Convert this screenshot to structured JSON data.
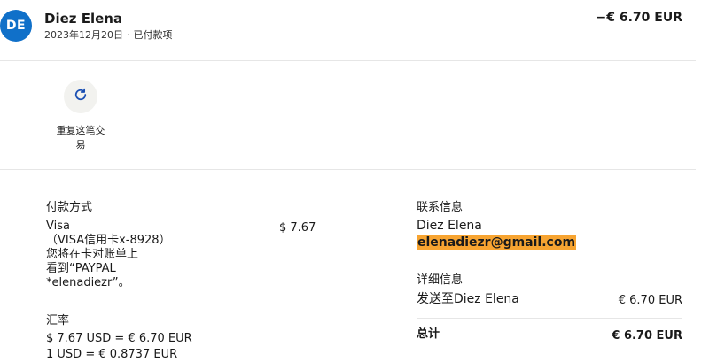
{
  "header": {
    "avatar_initials": "DE",
    "name": "Diez Elena",
    "date": "2023年12月20日",
    "separator": "·",
    "status": "已付款项",
    "amount": "−€ 6.70 EUR"
  },
  "actions": {
    "repeat_label": "重复这笔交易",
    "repeat_icon": "refresh-icon"
  },
  "payment_method": {
    "title": "付款方式",
    "lines": [
      "Visa",
      "（VISA信用卡x-8928）",
      "您将在卡对账单上",
      "看到“PAYPAL",
      "*elenadiezr”。"
    ],
    "amount": "$ 7.67"
  },
  "exchange_rate": {
    "title": "汇率",
    "line1": "$ 7.67 USD = € 6.70 EUR",
    "line2": "1 USD = € 0.8737 EUR"
  },
  "contact": {
    "title": "联系信息",
    "name": "Diez Elena",
    "email": "elenadiezr@gmail.com"
  },
  "details": {
    "title": "详细信息",
    "sent_to_label": "发送至Diez Elena",
    "sent_to_amount": "€ 6.70 EUR",
    "total_label": "总计",
    "total_amount": "€ 6.70 EUR"
  },
  "colors": {
    "avatar_bg": "#1070c9",
    "highlight": "#f7a431",
    "icon_blue": "#1a4fb3"
  }
}
